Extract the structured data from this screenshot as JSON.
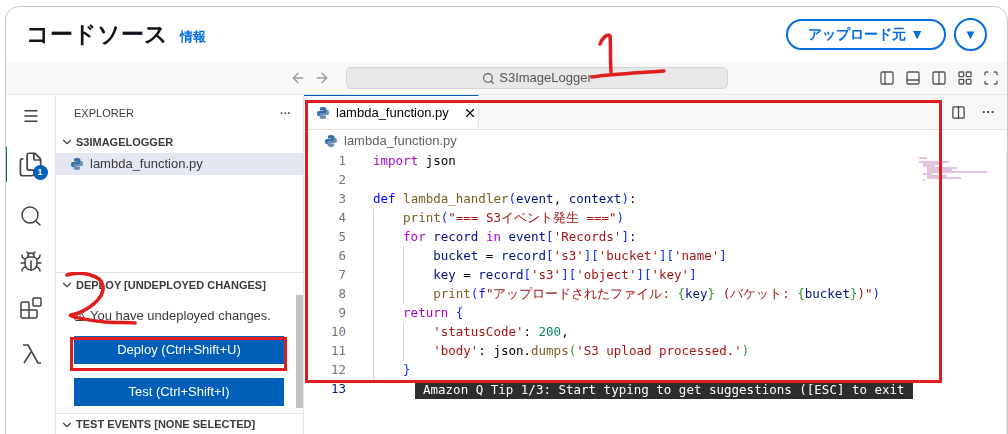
{
  "header": {
    "title": "コードソース",
    "info_link": "情報",
    "upload_button": "アップロード元 ▼",
    "menu_button": "▼"
  },
  "toolbar": {
    "search": "S3ImageLogger"
  },
  "explorer": {
    "title": "EXPLORER",
    "more": "···",
    "folder": {
      "name": "S3IMAGELOGGER",
      "expanded": true
    },
    "files": [
      {
        "name": "lambda_function.py",
        "selected": true
      }
    ],
    "badge": "1"
  },
  "deploy": {
    "title": "DEPLOY [UNDEPLOYED CHANGES]",
    "expanded": true,
    "message": "You have undeployed changes.",
    "buttons": [
      "Deploy (Ctrl+Shift+U)",
      "Test (Ctrl+Shift+I)"
    ]
  },
  "test_events": {
    "title": "TEST EVENTS [NONE SELECTED]",
    "expanded": true
  },
  "editor": {
    "tabs": [
      {
        "label": "lambda_function.py",
        "selected": true
      }
    ],
    "breadcrumb": "lambda_function.py",
    "lines": [
      {
        "n": "1",
        "tokens": [
          {
            "t": "import ",
            "kind": "control"
          },
          {
            "t": "json",
            "kind": "plain"
          }
        ]
      },
      {
        "n": "2"
      },
      {
        "n": "3",
        "tokens": [
          {
            "t": "def ",
            "kind": "keyword"
          },
          {
            "t": "lambda_handler",
            "kind": "function"
          },
          {
            "t": "(",
            "kind": "bracket1"
          },
          {
            "t": "event",
            "kind": "variable"
          },
          {
            "t": ", ",
            "kind": "plain"
          },
          {
            "t": "context",
            "kind": "variable"
          },
          {
            "t": ")",
            "kind": "bracket1"
          },
          {
            "t": ":",
            "kind": "plain"
          }
        ],
        "children": [
          {
            "n": "4",
            "tokens": [
              {
                "t": "print",
                "kind": "function"
              },
              {
                "t": "(",
                "kind": "bracket1"
              },
              {
                "t": "\"=== S3イベント発生 ===\"",
                "kind": "string"
              },
              {
                "t": ")",
                "kind": "bracket1"
              }
            ]
          },
          {
            "n": "5",
            "tokens": [
              {
                "t": "for ",
                "kind": "control"
              },
              {
                "t": "record ",
                "kind": "variable"
              },
              {
                "t": "in ",
                "kind": "control"
              },
              {
                "t": "event",
                "kind": "variable"
              },
              {
                "t": "[",
                "kind": "bracket1"
              },
              {
                "t": "'Records'",
                "kind": "string"
              },
              {
                "t": "]",
                "kind": "bracket1"
              },
              {
                "t": ":",
                "kind": "plain"
              }
            ],
            "children": [
              {
                "n": "6",
                "tokens": [
                  {
                    "t": "bucket",
                    "kind": "variable"
                  },
                  {
                    "t": " = ",
                    "kind": "plain"
                  },
                  {
                    "t": "record",
                    "kind": "variable"
                  },
                  {
                    "t": "[",
                    "kind": "bracket1"
                  },
                  {
                    "t": "'s3'",
                    "kind": "string"
                  },
                  {
                    "t": "][",
                    "kind": "bracket1"
                  },
                  {
                    "t": "'bucket'",
                    "kind": "string"
                  },
                  {
                    "t": "][",
                    "kind": "bracket1"
                  },
                  {
                    "t": "'name'",
                    "kind": "string"
                  },
                  {
                    "t": "]",
                    "kind": "bracket1"
                  }
                ]
              },
              {
                "n": "7",
                "tokens": [
                  {
                    "t": "key",
                    "kind": "variable"
                  },
                  {
                    "t": " = ",
                    "kind": "plain"
                  },
                  {
                    "t": "record",
                    "kind": "variable"
                  },
                  {
                    "t": "[",
                    "kind": "bracket1"
                  },
                  {
                    "t": "'s3'",
                    "kind": "string"
                  },
                  {
                    "t": "][",
                    "kind": "bracket1"
                  },
                  {
                    "t": "'object'",
                    "kind": "string"
                  },
                  {
                    "t": "][",
                    "kind": "bracket1"
                  },
                  {
                    "t": "'key'",
                    "kind": "string"
                  },
                  {
                    "t": "]",
                    "kind": "bracket1"
                  }
                ]
              },
              {
                "n": "8",
                "tokens": [
                  {
                    "t": "print",
                    "kind": "function"
                  },
                  {
                    "t": "(",
                    "kind": "bracket1"
                  },
                  {
                    "t": "f",
                    "kind": "keyword"
                  },
                  {
                    "t": "\"アップロードされたファイル: ",
                    "kind": "string"
                  },
                  {
                    "t": "{",
                    "kind": "bracket2"
                  },
                  {
                    "t": "key",
                    "kind": "variable"
                  },
                  {
                    "t": "}",
                    "kind": "bracket2"
                  },
                  {
                    "t": " (バケット: ",
                    "kind": "string"
                  },
                  {
                    "t": "{",
                    "kind": "bracket2"
                  },
                  {
                    "t": "bucket",
                    "kind": "variable"
                  },
                  {
                    "t": "}",
                    "kind": "bracket2"
                  },
                  {
                    "t": ")\"",
                    "kind": "string"
                  },
                  {
                    "t": ")",
                    "kind": "bracket1"
                  }
                ]
              }
            ]
          },
          {
            "n": "9",
            "tokens": [
              {
                "t": "return ",
                "kind": "control"
              },
              {
                "t": "{",
                "kind": "bracket1"
              }
            ],
            "children": [
              {
                "n": "10",
                "tokens": [
                  {
                    "t": "'statusCode'",
                    "kind": "string"
                  },
                  {
                    "t": ": ",
                    "kind": "plain"
                  },
                  {
                    "t": "200",
                    "kind": "number"
                  },
                  {
                    "t": ",",
                    "kind": "plain"
                  }
                ]
              },
              {
                "n": "11",
                "tokens": [
                  {
                    "t": "'body'",
                    "kind": "string"
                  },
                  {
                    "t": ": ",
                    "kind": "plain"
                  },
                  {
                    "t": "json",
                    "kind": "plain"
                  },
                  {
                    "t": ".",
                    "kind": "plain"
                  },
                  {
                    "t": "dumps",
                    "kind": "function"
                  },
                  {
                    "t": "(",
                    "kind": "bracket2"
                  },
                  {
                    "t": "'S3 upload processed.'",
                    "kind": "string"
                  },
                  {
                    "t": ")",
                    "kind": "bracket2"
                  }
                ]
              }
            ]
          },
          {
            "n": "12",
            "tokens": [
              {
                "t": "}",
                "kind": "bracket1"
              }
            ]
          }
        ]
      },
      {
        "n": "13"
      }
    ],
    "tip": "Amazon Q Tip 1/3: Start typing to get suggestions ([ESC] to exit"
  }
}
